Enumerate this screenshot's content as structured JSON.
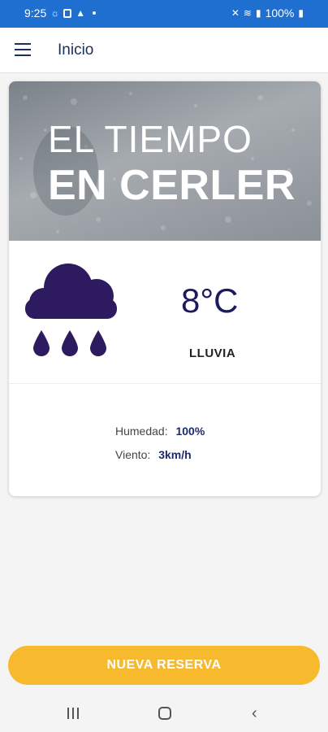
{
  "status_bar": {
    "time": "9:25",
    "battery": "100%"
  },
  "app_bar": {
    "title": "Inicio"
  },
  "weather": {
    "banner_line1": "EL TIEMPO",
    "banner_line2": "EN CERLER",
    "temperature": "8°C",
    "condition": "LLUVIA",
    "humidity_label": "Humedad:",
    "humidity_value": "100%",
    "wind_label": "Viento:",
    "wind_value": "3km/h",
    "icon": "rain-cloud-icon",
    "icon_color": "#2e1a5e"
  },
  "actions": {
    "reserve_label": "NUEVA RESERVA",
    "reserve_color": "#f7b92e"
  },
  "colors": {
    "status_bar": "#1e6fd0",
    "accent_text": "#1d2a6e"
  }
}
